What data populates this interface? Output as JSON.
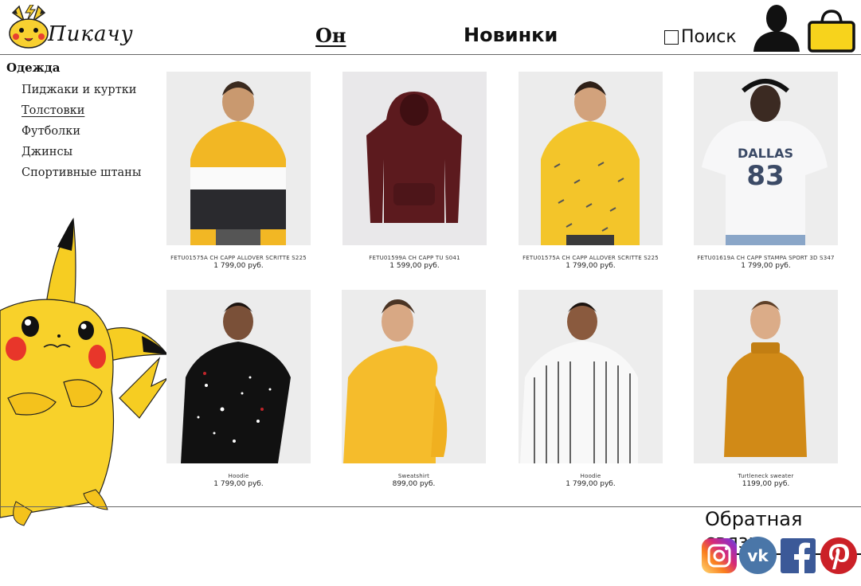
{
  "header": {
    "logo_text": "Пикачу",
    "nav_on": "Он",
    "nav_new": "Новинки",
    "search_label": "Поиск"
  },
  "sidebar": {
    "title": "Одежда",
    "items": [
      {
        "label": "Пиджаки и куртки",
        "active": false
      },
      {
        "label": "Толстовки",
        "active": true
      },
      {
        "label": "Футболки",
        "active": false
      },
      {
        "label": "Джинсы",
        "active": false
      },
      {
        "label": "Спортивные штаны",
        "active": false
      }
    ]
  },
  "products": [
    {
      "name": "FETU01575A CH CAPP ALLOVER SCRITTE S225",
      "price": "1 799,00 руб.",
      "image": "yellow-white-black-colorblock-hoodie"
    },
    {
      "name": "FETU01599A CH CAPP TU S041",
      "price": "1 599,00 руб.",
      "image": "burgundy-hoodie"
    },
    {
      "name": "FETU01575A CH CAPP ALLOVER SCRITTE S225",
      "price": "1 799,00 руб.",
      "image": "yellow-allover-print-hoodie"
    },
    {
      "name": "FETU01619A CH CAPP STAMPA SPORT 3D S347",
      "price": "1 799,00 руб.",
      "image": "white-dallas-83-hoodie"
    },
    {
      "name": "Hoodie",
      "price": "1 799,00 руб.",
      "image": "black-splatter-hoodie"
    },
    {
      "name": "Sweatshirt",
      "price": "899,00 руб.",
      "image": "yellow-sweatshirt"
    },
    {
      "name": "Hoodie",
      "price": "1 799,00 руб.",
      "image": "white-striped-hoodie"
    },
    {
      "name": "Turtleneck sweater",
      "price": "1199,00 руб.",
      "image": "mustard-turtleneck-sweater"
    }
  ],
  "footer": {
    "feedback_label": "Обратная связь",
    "social": [
      "instagram-icon",
      "vk-icon",
      "facebook-icon",
      "pinterest-icon"
    ]
  },
  "colors": {
    "cart": "#f7d31c",
    "instagram": "#c13584",
    "vk": "#4a76a8",
    "facebook": "#3b5998",
    "pinterest": "#cb2027"
  }
}
